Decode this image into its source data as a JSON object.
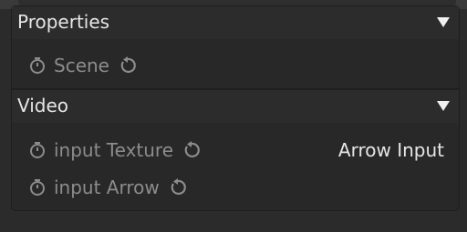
{
  "sections": [
    {
      "title": "Properties",
      "rows": [
        {
          "label": "Scene"
        }
      ]
    },
    {
      "title": "Video",
      "rows": [
        {
          "label": "input Texture",
          "value": "Arrow Input"
        },
        {
          "label": "input Arrow"
        }
      ]
    }
  ],
  "icons": {
    "timer": "stopwatch-icon",
    "reset": "reset-icon",
    "collapse": "triangle-down-icon"
  },
  "colors": {
    "background": "#2b2b2b",
    "panel": "#282828",
    "header": "#2c2c2c",
    "text": "#e6e6e6",
    "dim_text": "#8c8c8c"
  }
}
